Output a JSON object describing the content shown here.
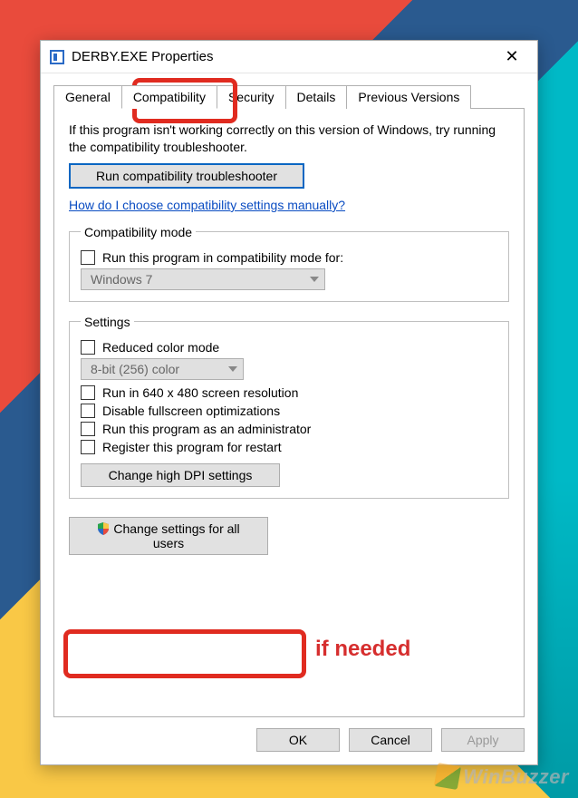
{
  "title": "DERBY.EXE Properties",
  "tabs": {
    "general": "General",
    "compatibility": "Compatibility",
    "security": "Security",
    "details": "Details",
    "previous": "Previous Versions"
  },
  "intro": "If this program isn't working correctly on this version of Windows, try running the compatibility troubleshooter.",
  "runTroubleshooter": "Run compatibility troubleshooter",
  "helpLink": "How do I choose compatibility settings manually?",
  "compatMode": {
    "legend": "Compatibility mode",
    "check": "Run this program in compatibility mode for:",
    "selected": "Windows 7"
  },
  "settings": {
    "legend": "Settings",
    "reducedColor": "Reduced color mode",
    "colorSelected": "8-bit (256) color",
    "lowRes": "Run in 640 x 480 screen resolution",
    "disableFullscreen": "Disable fullscreen optimizations",
    "runAdmin": "Run this program as an administrator",
    "registerRestart": "Register this program for restart",
    "highDpi": "Change high DPI settings"
  },
  "allUsers": "Change settings for all users",
  "buttons": {
    "ok": "OK",
    "cancel": "Cancel",
    "apply": "Apply"
  },
  "annotation": "if needed",
  "watermark": "WinBuzzer"
}
